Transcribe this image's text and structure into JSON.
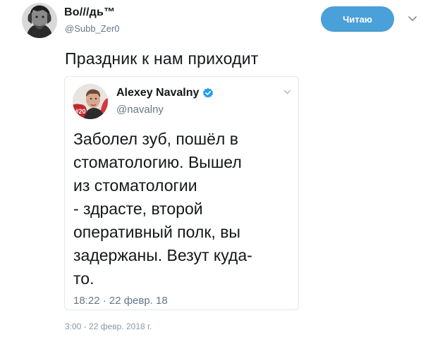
{
  "author": {
    "display_name": "Во///дь™",
    "handle": "@Subb_Zer0",
    "avatar_icon": "portrait-avatar-icon"
  },
  "follow_button": {
    "label": "Читаю",
    "color": "#4aa0d8"
  },
  "tweet": {
    "text": "Праздник к нам приходит",
    "timestamp": "3:00 - 22 февр. 2018 г."
  },
  "quoted_tweet": {
    "display_name": "Alexey Navalny",
    "handle": "@navalny",
    "verified": true,
    "verified_color": "#1da1f2",
    "avatar_badge": "#20",
    "text": "Заболел зуб, пошёл в\nстоматологию. Вышел\nиз стоматологии\n- здрасте, второй\nоперативный полк, вы\nзадержаны. Везут куда-\nто.",
    "time": "18:22 · 22 февр. 18"
  }
}
